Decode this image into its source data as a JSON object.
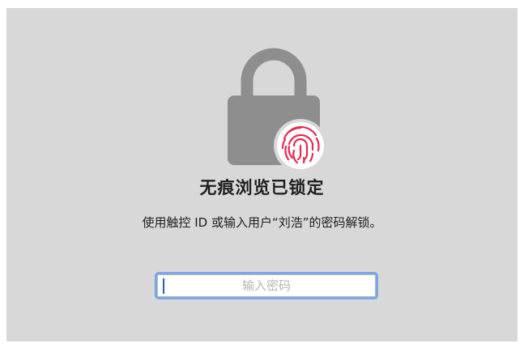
{
  "lock_screen": {
    "title": "无痕浏览已锁定",
    "subtitle": "使用触控 ID 或输入用户“刘浩”的密码解锁。",
    "password_placeholder": "输入密码",
    "password_value": ""
  },
  "icons": {
    "lock": "lock-icon",
    "fingerprint": "fingerprint-icon"
  },
  "colors": {
    "panel_background": "#d8d8d8",
    "lock_gray": "#8e8e8e",
    "fingerprint_accent": "#e8294e",
    "focus_ring": "#7aa7e8"
  }
}
